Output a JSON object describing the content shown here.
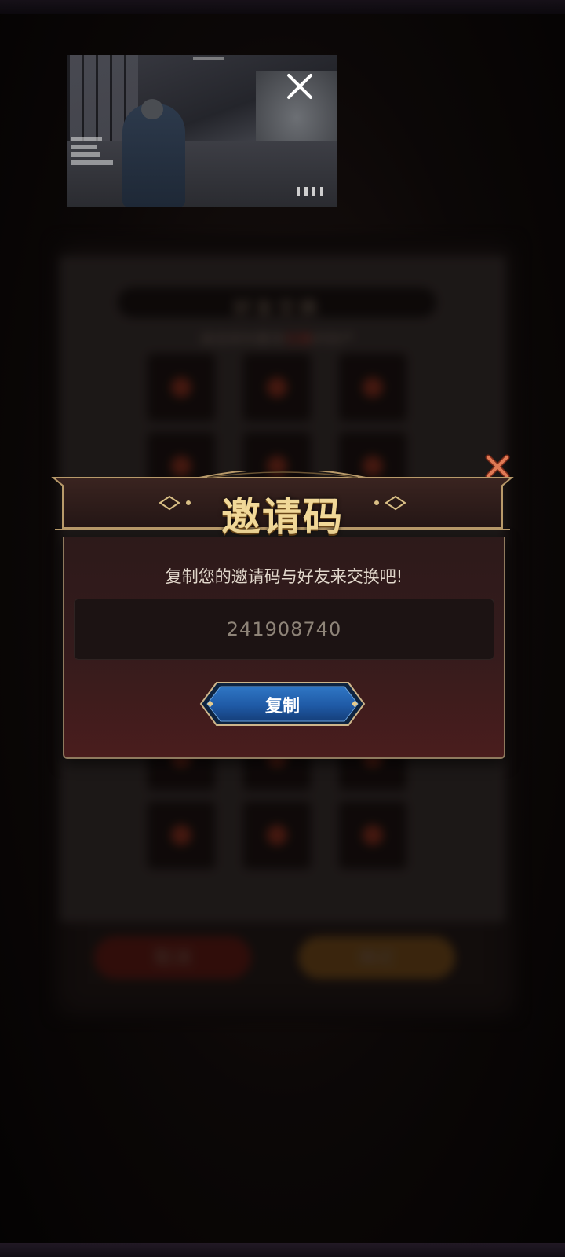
{
  "background_panel": {
    "title": "好友交换",
    "subtitle_parts": [
      "请选择你要用",
      "交换",
      "的财产"
    ],
    "cancel_label": "取消",
    "confirm_label": "确定"
  },
  "video_thumbnail": {
    "close_icon": "close-icon"
  },
  "invite_dialog": {
    "title": "邀请码",
    "description": "复制您的邀请码与好友来交换吧!",
    "invite_code": "241908740",
    "copy_label": "复制",
    "close_icon": "close-icon"
  },
  "colors": {
    "title_gold": "#f1d898",
    "dialog_border": "#8f7a5e",
    "copy_button_blue": "#1f5aa6",
    "close_x_orange": "#e07a55"
  }
}
